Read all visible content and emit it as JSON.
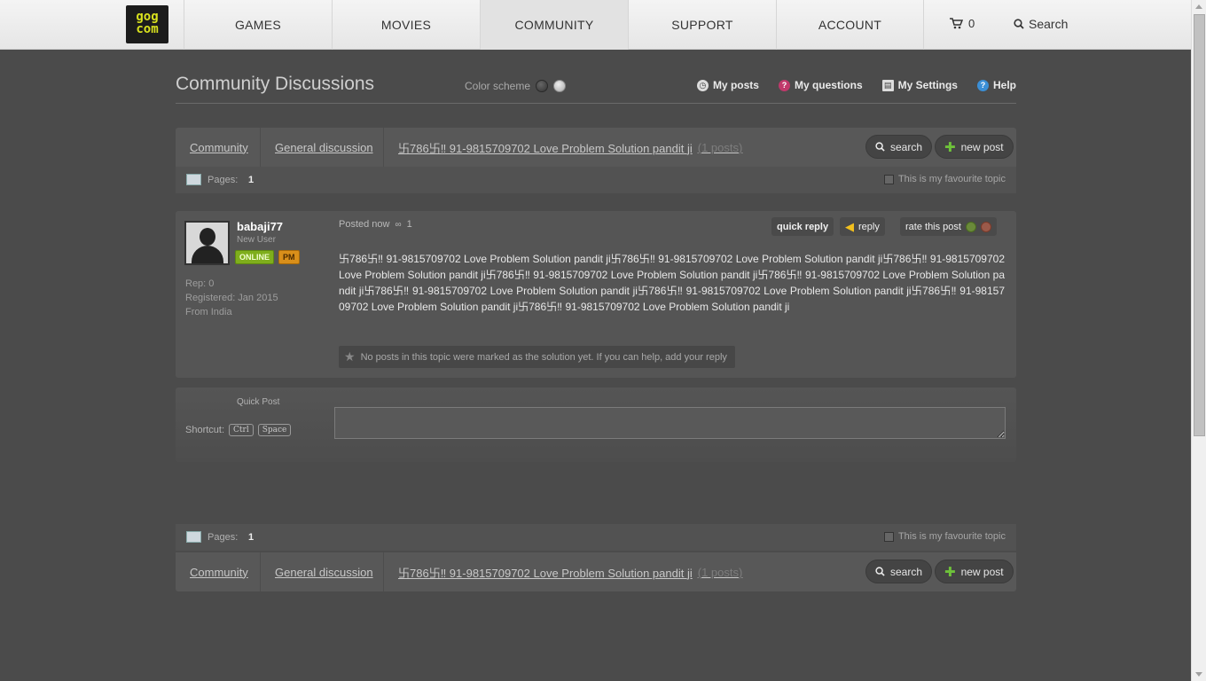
{
  "topnav": {
    "logo_top": "gog",
    "logo_bottom": "com",
    "items": [
      {
        "label": "GAMES"
      },
      {
        "label": "MOVIES"
      },
      {
        "label": "COMMUNITY"
      },
      {
        "label": "SUPPORT"
      },
      {
        "label": "ACCOUNT"
      }
    ],
    "cart_count": "0",
    "search_label": "Search"
  },
  "header": {
    "title": "Community Discussions",
    "color_scheme_label": "Color scheme",
    "links": [
      {
        "label": "My posts",
        "icon": "clock-icon"
      },
      {
        "label": "My questions",
        "icon": "question-icon"
      },
      {
        "label": "My Settings",
        "icon": "settings-icon"
      },
      {
        "label": "Help",
        "icon": "help-icon"
      }
    ]
  },
  "breadcrumb": {
    "community": "Community",
    "forum": "General discussion",
    "topic": "卐786卐‼ 91-9815709702 Love Problem Solution pandit ji",
    "post_count": "(1 posts)",
    "search_label": "search",
    "new_post_label": "new post"
  },
  "pages": {
    "label": "Pages:",
    "current": "1",
    "favourite_label": "This is my favourite topic"
  },
  "post": {
    "username": "babaji77",
    "user_type": "New User",
    "online_badge": "ONLINE",
    "pm_badge": "PM",
    "rep": "Rep: 0",
    "registered": "Registered: Jan 2015",
    "from": "From India",
    "posted": "Posted now",
    "link_count": "1",
    "quick_reply": "quick reply",
    "reply": "reply",
    "rate": "rate this post",
    "body": "卐786卐‼ 91-9815709702 Love Problem Solution pandit ji卐786卐‼ 91-9815709702 Love Problem Solution pandit ji卐786卐‼ 91-9815709702 Love Problem Solution pandit ji卐786卐‼ 91-9815709702 Love Problem Solution pandit ji卐786卐‼ 91-9815709702 Love Problem Solution pandit ji卐786卐‼ 91-9815709702 Love Problem Solution pandit ji卐786卐‼ 91-9815709702 Love Problem Solution pandit ji卐786卐‼ 91-9815709702 Love Problem Solution pandit ji卐786卐‼ 91-9815709702 Love Problem Solution pandit ji",
    "solution_note": "No posts in this topic were marked as the solution yet. If you can help, add your reply"
  },
  "quickpost": {
    "label": "Quick Post",
    "shortcut_label": "Shortcut:",
    "key1": "Ctrl",
    "key2": "Space"
  },
  "colors": {
    "background": "#4b4b4b",
    "online": "#7fae1c",
    "pm": "#d98f1a",
    "logo": "#d9e21e"
  }
}
